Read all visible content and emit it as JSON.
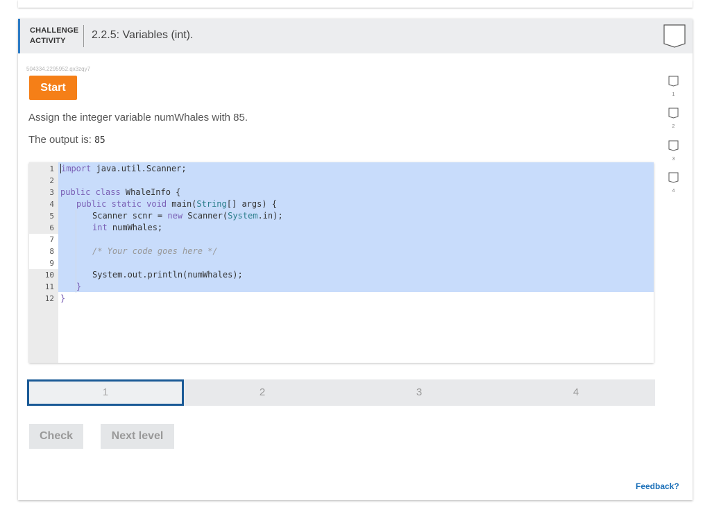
{
  "header": {
    "type_line1": "CHALLENGE",
    "type_line2": "ACTIVITY",
    "title": "2.2.5: Variables (int)."
  },
  "activity_id": "504334.2295952.qx3zqy7",
  "start_label": "Start",
  "prompt": "Assign the integer variable numWhales with 85.",
  "output_label": "The output is: ",
  "output_value": "85",
  "code": {
    "line_numbers": [
      "1",
      "2",
      "3",
      "4",
      "5",
      "6",
      "7",
      "8",
      "9",
      "10",
      "11",
      "12"
    ],
    "l1_kw": "import",
    "l1_rest": " java.util.Scanner;",
    "l3_kw": "public class",
    "l3_rest": " WhaleInfo {",
    "l4_kw": "public static void",
    "l4_rest": " main(",
    "l4_type": "String",
    "l4_end": "[] args) {",
    "l5_a": "Scanner scnr = ",
    "l5_kw": "new",
    "l5_b": " Scanner(",
    "l5_type": "System",
    "l5_c": ".in);",
    "l6_kw": "int",
    "l6_rest": " numWhales;",
    "l8_comment": "/* Your code goes here */",
    "l10": "System.out.println(numWhales);",
    "l11": "}",
    "l12": "}"
  },
  "level_nav": [
    "1",
    "2",
    "3",
    "4"
  ],
  "side_levels": [
    "1",
    "2",
    "3",
    "4"
  ],
  "active_level": 1,
  "check_label": "Check",
  "next_label": "Next level",
  "feedback_label": "Feedback?",
  "colors": {
    "accent": "#2c7bc5",
    "start": "#f57f17",
    "selection": "#c8dcfb",
    "active_level_border": "#1a5a96",
    "feedback": "#1a6fb8"
  }
}
